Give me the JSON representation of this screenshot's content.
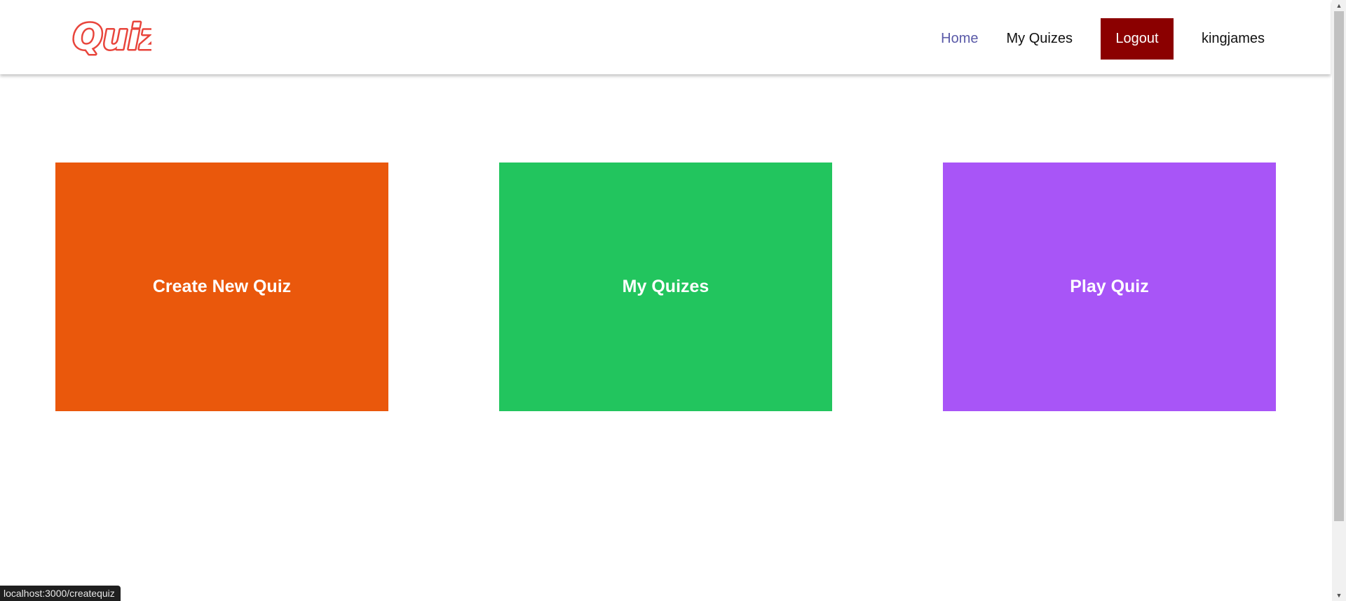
{
  "brand": {
    "logo_text": "Quiz",
    "logo_color": "#e8453c"
  },
  "nav": {
    "home_label": "Home",
    "myquizes_label": "My Quizes",
    "logout_label": "Logout",
    "username": "kingjames",
    "home_color": "#5a5aa8",
    "logout_bg": "#8b0000"
  },
  "cards": [
    {
      "label": "Create New Quiz",
      "color": "#ea580c"
    },
    {
      "label": "My Quizes",
      "color": "#22c55e"
    },
    {
      "label": "Play Quiz",
      "color": "#a855f7"
    }
  ],
  "status_bar": {
    "url": "localhost:3000/createquiz"
  }
}
